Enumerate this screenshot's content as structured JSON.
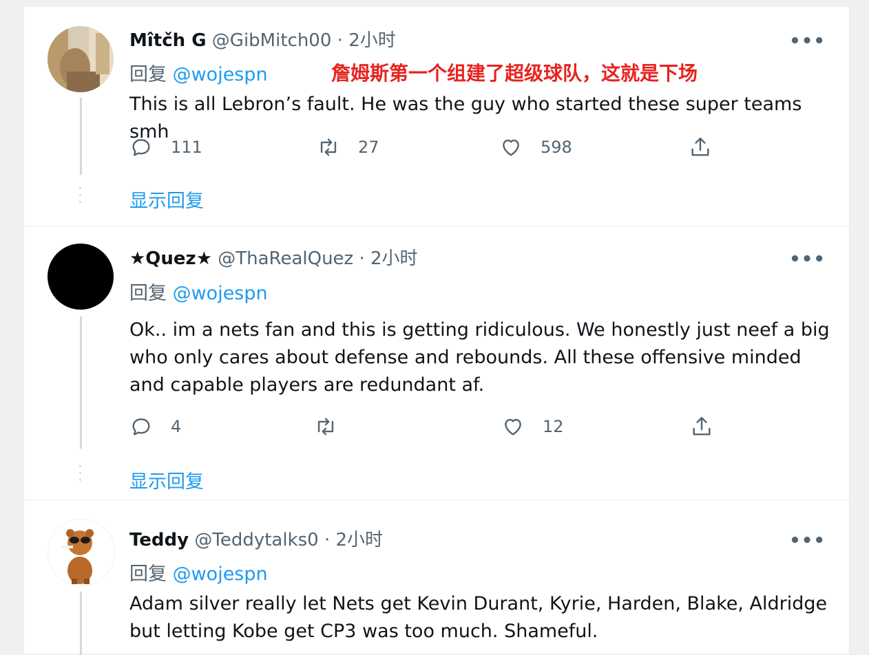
{
  "tweets": [
    {
      "name": "Mîtčh G",
      "handle": "@GibMitch00",
      "separator": "·",
      "time": "2小时",
      "more": "•••",
      "reply_prefix": "回复",
      "reply_to": "@wojespn",
      "annotation": "詹姆斯第一个组建了超级球队，这就是下场",
      "text": "This is all Lebron’s fault. He was the guy who started these super teams smh",
      "replies": "111",
      "retweets": "27",
      "likes": "598",
      "show_replies": "显示回复"
    },
    {
      "name": "★Quez★",
      "handle": "@ThaRealQuez",
      "separator": "·",
      "time": "2小时",
      "more": "•••",
      "reply_prefix": "回复",
      "reply_to": "@wojespn",
      "text": "Ok.. im a nets fan and this is getting ridiculous. We honestly just neef a big who only cares about defense and rebounds. All these offensive minded and capable players are redundant af.",
      "replies": "4",
      "retweets": "",
      "likes": "12",
      "show_replies": "显示回复"
    },
    {
      "name": "Teddy",
      "handle": "@Teddytalks0",
      "separator": "·",
      "time": "2小时",
      "more": "•••",
      "reply_prefix": "回复",
      "reply_to": "@wojespn",
      "text": "Adam silver really let Nets get Kevin Durant, Kyrie, Harden, Blake, Aldridge but letting Kobe get CP3 was too much. Shameful."
    }
  ],
  "icons": {
    "reply": "reply-icon",
    "retweet": "retweet-icon",
    "like": "heart-icon",
    "share": "share-icon",
    "more": "more-icon"
  },
  "colors": {
    "link": "#1d9bf0",
    "annotation": "#e8231f",
    "muted": "#536471"
  }
}
